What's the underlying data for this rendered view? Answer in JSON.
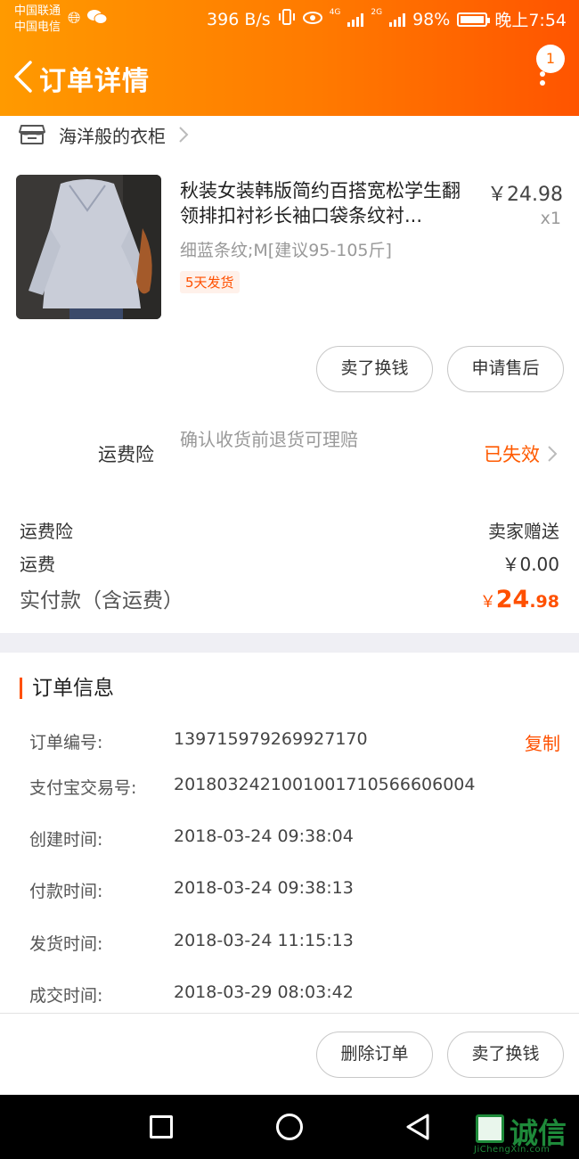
{
  "status_bar": {
    "carrier1": "中国联通",
    "carrier2": "中国电信",
    "speed": "396 B/s",
    "net1": "4G",
    "net2": "2G",
    "battery": "98%",
    "time": "晚上7:54"
  },
  "nav": {
    "title": "订单详情",
    "badge": "1"
  },
  "shop": {
    "name": "海洋般的衣柜"
  },
  "product": {
    "title": "秋装女装韩版简约百搭宽松学生翻领排扣衬衫长袖口袋条纹衬...",
    "price": "￥24.98",
    "qty": "x1",
    "sku": "细蓝条纹;M[建议95-105斤]",
    "tag": "5天发货",
    "buttons": {
      "sell": "卖了换钱",
      "aftersale": "申请售后"
    }
  },
  "insurance": {
    "label": "运费险",
    "desc": "确认收货前退货可理赔",
    "status": "已失效"
  },
  "fees": {
    "ins_label": "运费险",
    "ins_value": "卖家赠送",
    "ship_label": "运费",
    "ship_value": "￥0.00",
    "total_label": "实付款（含运费）",
    "total_currency": "￥",
    "total_int": "24",
    "total_dec": ".98"
  },
  "order_info": {
    "title": "订单信息",
    "rows": [
      {
        "key": "订单编号:",
        "value": "139715979269927170",
        "action": "复制"
      },
      {
        "key": "支付宝交易号:",
        "value": "2018032421001001710566606004"
      },
      {
        "key": "创建时间:",
        "value": "2018-03-24 09:38:04"
      },
      {
        "key": "付款时间:",
        "value": "2018-03-24 09:38:13"
      },
      {
        "key": "发货时间:",
        "value": "2018-03-24 11:15:13"
      },
      {
        "key": "成交时间:",
        "value": "2018-03-29 08:03:42"
      }
    ]
  },
  "bottom": {
    "delete": "删除订单",
    "sell": "卖了换钱"
  },
  "watermark": {
    "text": "诚信",
    "sub": "JiChengXin.com"
  },
  "colors": {
    "accent": "#ff5000",
    "header_start": "#ff9a00",
    "header_end": "#ff5400"
  }
}
